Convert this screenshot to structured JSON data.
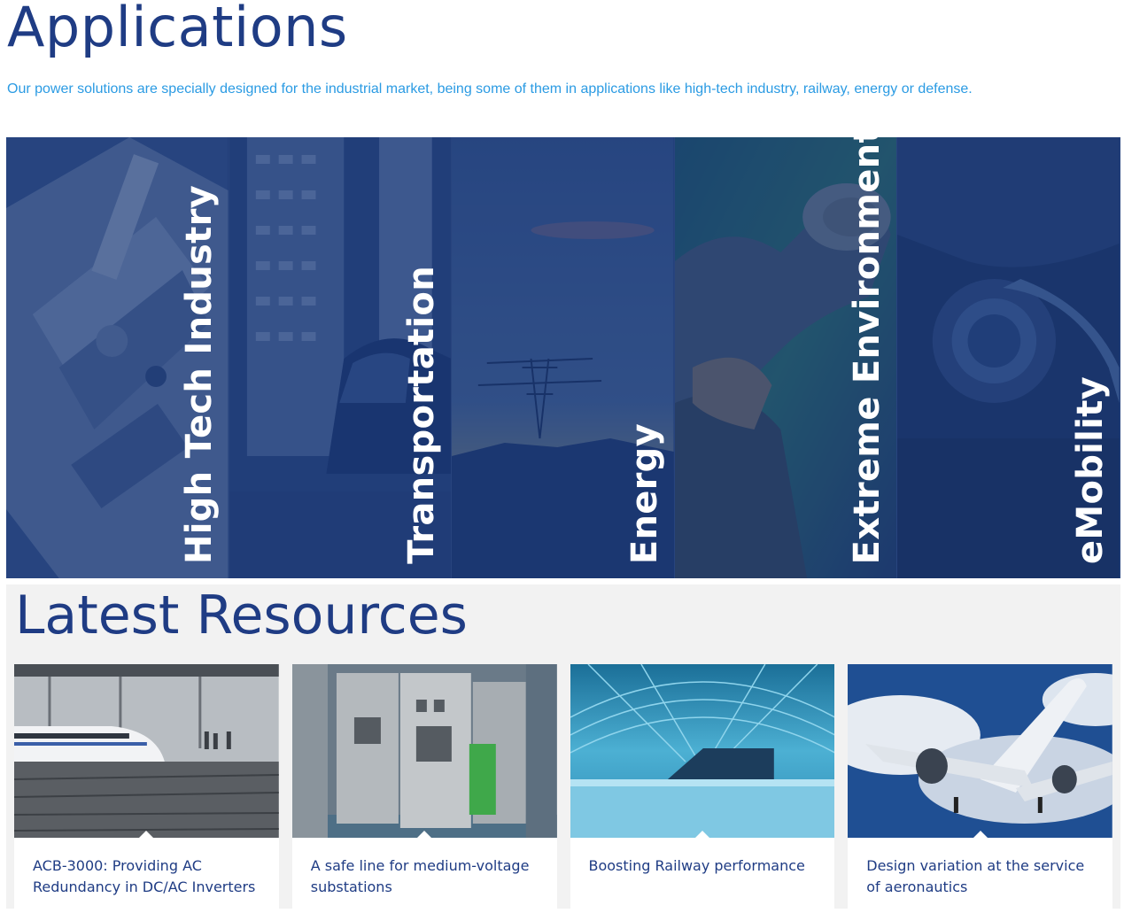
{
  "header": {
    "title": "Applications",
    "intro": "Our power solutions are specially designed for the industrial market, being some of them in applications like high-tech industry, railway, energy or defense."
  },
  "applications": [
    {
      "label": "High Tech Industry"
    },
    {
      "label": "Transportation"
    },
    {
      "label": "Energy"
    },
    {
      "label": "Extreme Environments"
    },
    {
      "label": "eMobility"
    }
  ],
  "resources": {
    "title": "Latest Resources",
    "cards": [
      {
        "title": "ACB-3000: Providing AC Redundancy in DC/AC Inverters"
      },
      {
        "title": "A safe line for medium-voltage substations"
      },
      {
        "title": "Boosting Railway performance"
      },
      {
        "title": "Design variation at the service of aeronautics"
      }
    ]
  },
  "colors": {
    "brand_blue": "#1f3c84",
    "accent_blue": "#2b9be3",
    "panel_tint": "#1d3a78",
    "resources_bg": "#f2f2f2"
  }
}
